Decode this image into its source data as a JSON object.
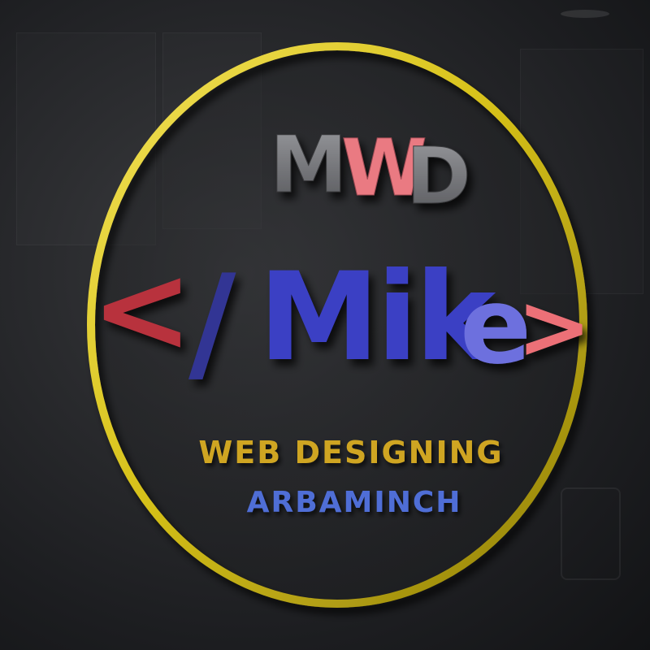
{
  "logo": {
    "monogram": {
      "part1": "M",
      "part2": "W",
      "part3": "D"
    },
    "title": {
      "open_bracket": "<",
      "slash": "/",
      "name_main": "Mik",
      "name_end": "e",
      "close_bracket": ">"
    },
    "tagline": "WEB DESIGNING",
    "location": "ARBAMINCH"
  },
  "colors": {
    "ring": "#d7c21a",
    "monogram_grey": "#6d6e72",
    "monogram_pink": "#ea7a82",
    "bracket_red": "#b8313d",
    "bracket_pink": "#ec7077",
    "slash_blue": "#323594",
    "mike_blue": "#3b3fc4",
    "e_blue": "#6d70de",
    "tagline_gold": "#cfa524",
    "location_blue": "#4f6ed6"
  }
}
